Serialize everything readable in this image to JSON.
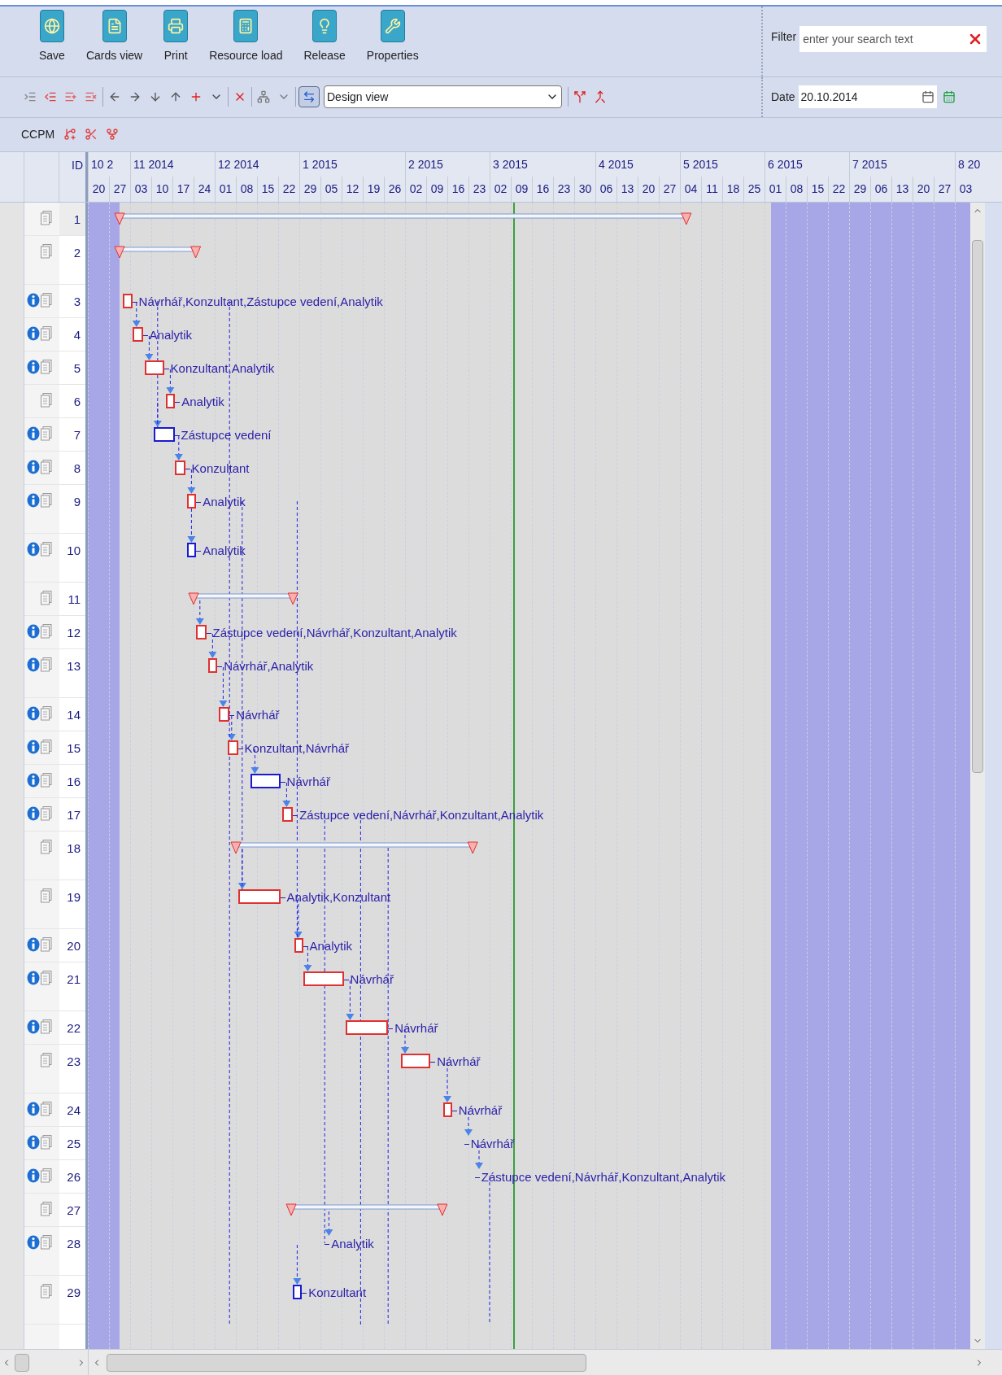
{
  "ribbon": {
    "buttons": [
      {
        "label": "Save"
      },
      {
        "label": "Cards view"
      },
      {
        "label": "Print"
      },
      {
        "label": "Resource load"
      },
      {
        "label": "Release"
      },
      {
        "label": "Properties"
      }
    ]
  },
  "filter": {
    "label": "Filter",
    "placeholder": "enter your search text"
  },
  "toolbar": {
    "toggle": {
      "selected": true
    },
    "view_select": {
      "value": "Design view"
    },
    "date": {
      "label": "Date",
      "value": "20.10.2014"
    }
  },
  "ccpm": {
    "label": "CCPM"
  },
  "timeline": {
    "id_heading": "ID",
    "months": [
      {
        "label": "10 2",
        "weeks": [
          "20",
          "27"
        ]
      },
      {
        "label": "11 2014",
        "weeks": [
          "03",
          "10",
          "17",
          "24"
        ]
      },
      {
        "label": "12 2014",
        "weeks": [
          "01",
          "08",
          "15",
          "22"
        ]
      },
      {
        "label": "1 2015",
        "weeks": [
          "29",
          "05",
          "12",
          "19",
          "26"
        ]
      },
      {
        "label": "2 2015",
        "weeks": [
          "02",
          "09",
          "16",
          "23"
        ]
      },
      {
        "label": "3 2015",
        "weeks": [
          "02",
          "09",
          "16",
          "23",
          "30"
        ]
      },
      {
        "label": "4 2015",
        "weeks": [
          "06",
          "13",
          "20",
          "27"
        ]
      },
      {
        "label": "5 2015",
        "weeks": [
          "04",
          "11",
          "18",
          "25"
        ]
      },
      {
        "label": "6 2015",
        "weeks": [
          "01",
          "08",
          "15",
          "22"
        ]
      },
      {
        "label": "7 2015",
        "weeks": [
          "29",
          "06",
          "13",
          "20",
          "27"
        ]
      },
      {
        "label": "8 20",
        "weeks": [
          "03"
        ]
      }
    ]
  },
  "rows": [
    {
      "number": "1",
      "info": false,
      "tall": false,
      "kind": "summary"
    },
    {
      "number": "2",
      "info": false,
      "tall": true,
      "kind": "summary"
    },
    {
      "number": "3",
      "info": true,
      "tall": false,
      "kind": "task",
      "color": "#e03030",
      "label": "Návrhář,Konzultant,Zástupce vedení,Analytik"
    },
    {
      "number": "4",
      "info": true,
      "tall": false,
      "kind": "task",
      "color": "#e03030",
      "label": "Analytik"
    },
    {
      "number": "5",
      "info": true,
      "tall": false,
      "kind": "task",
      "color": "#e03030",
      "label": "Konzultant,Analytik"
    },
    {
      "number": "6",
      "info": false,
      "tall": false,
      "kind": "task",
      "color": "#e03030",
      "label": "Analytik"
    },
    {
      "number": "7",
      "info": true,
      "tall": false,
      "kind": "task",
      "color": "#1a1ad0",
      "label": "Zástupce vedení"
    },
    {
      "number": "8",
      "info": true,
      "tall": false,
      "kind": "task",
      "color": "#e03030",
      "label": "Konzultant"
    },
    {
      "number": "9",
      "info": true,
      "tall": true,
      "kind": "task",
      "color": "#e03030",
      "label": "Analytik"
    },
    {
      "number": "10",
      "info": true,
      "tall": true,
      "kind": "task",
      "color": "#1a1ad0",
      "label": "Analytik"
    },
    {
      "number": "11",
      "info": false,
      "tall": false,
      "kind": "summary"
    },
    {
      "number": "12",
      "info": true,
      "tall": false,
      "kind": "task",
      "color": "#e03030",
      "label": "Zástupce vedení,Návrhář,Konzultant,Analytik"
    },
    {
      "number": "13",
      "info": true,
      "tall": true,
      "kind": "task",
      "color": "#e03030",
      "label": "Návrhář,Analytik"
    },
    {
      "number": "14",
      "info": true,
      "tall": false,
      "kind": "task",
      "color": "#e03030",
      "label": "Návrhář"
    },
    {
      "number": "15",
      "info": true,
      "tall": false,
      "kind": "task",
      "color": "#e03030",
      "label": "Konzultant,Návrhář"
    },
    {
      "number": "16",
      "info": true,
      "tall": false,
      "kind": "task",
      "color": "#1a1ad0",
      "label": "Návrhář"
    },
    {
      "number": "17",
      "info": true,
      "tall": false,
      "kind": "task",
      "color": "#e03030",
      "label": "Zástupce vedení,Návrhář,Konzultant,Analytik"
    },
    {
      "number": "18",
      "info": false,
      "tall": true,
      "kind": "summary"
    },
    {
      "number": "19",
      "info": false,
      "tall": true,
      "kind": "task",
      "color": "#e03030",
      "label": "Analytik,Konzultant"
    },
    {
      "number": "20",
      "info": true,
      "tall": false,
      "kind": "task",
      "color": "#e03030",
      "label": "Analytik"
    },
    {
      "number": "21",
      "info": true,
      "tall": true,
      "kind": "task",
      "color": "#e03030",
      "label": "Návrhář"
    },
    {
      "number": "22",
      "info": true,
      "tall": false,
      "kind": "task",
      "color": "#e03030",
      "label": "Návrhář"
    },
    {
      "number": "23",
      "info": false,
      "tall": true,
      "kind": "task",
      "color": "#e03030",
      "label": "Návrhář"
    },
    {
      "number": "24",
      "info": true,
      "tall": false,
      "kind": "task",
      "color": "#e03030",
      "label": "Návrhář"
    },
    {
      "number": "25",
      "info": true,
      "tall": false,
      "kind": "label",
      "label": "Návrhář"
    },
    {
      "number": "26",
      "info": true,
      "tall": false,
      "kind": "label",
      "label": "Zástupce vedení,Návrhář,Konzultant,Analytik"
    },
    {
      "number": "27",
      "info": false,
      "tall": false,
      "kind": "summary"
    },
    {
      "number": "28",
      "info": true,
      "tall": true,
      "kind": "label",
      "label": "Analytik"
    },
    {
      "number": "29",
      "info": false,
      "tall": true,
      "kind": "task",
      "color": "#1a1ad0",
      "label": "Konzultant"
    }
  ]
}
